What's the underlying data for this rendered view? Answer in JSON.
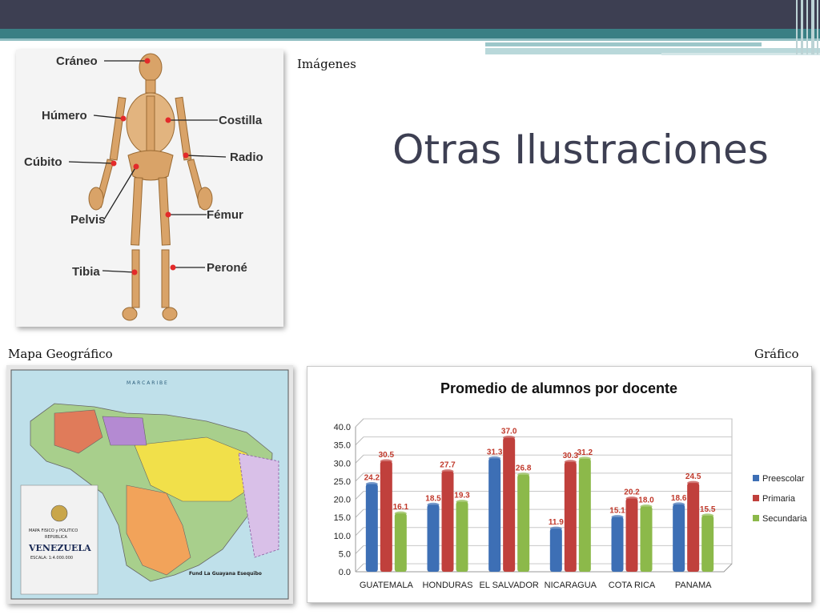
{
  "slide": {
    "title": "Otras Ilustraciones",
    "caption_images": "Imágenes",
    "caption_map": "Mapa Geográfico",
    "caption_chart": "Gráfico"
  },
  "skeleton": {
    "labels": [
      "Cráneo",
      "Húmero",
      "Costilla",
      "Cúbito",
      "Radio",
      "Pelvis",
      "Fémur",
      "Tibia",
      "Peroné"
    ]
  },
  "map": {
    "top_text": "M A R   C A R I B E",
    "legend_title_1": "MAPA FISICO y POLITICO",
    "legend_title_2": "REPUBLICA",
    "country": "VENEZUELA",
    "scale": "ESCALA: 1:4.000.000",
    "zone_label": "Fund La Guayana Esequibo"
  },
  "chart_data": {
    "type": "bar",
    "title": "Promedio de alumnos por docente",
    "categories": [
      "GUATEMALA",
      "HONDURAS",
      "EL SALVADOR",
      "NICARAGUA",
      "COTA RICA",
      "PANAMA"
    ],
    "series": [
      {
        "name": "Preescolar",
        "color": "#3d6fb5",
        "values": [
          24.2,
          18.5,
          31.3,
          11.9,
          15.1,
          18.6
        ]
      },
      {
        "name": "Primaria",
        "color": "#c0403c",
        "values": [
          30.5,
          27.7,
          37.0,
          30.3,
          20.2,
          24.5
        ]
      },
      {
        "name": "Secundaria",
        "color": "#8cb94a",
        "values": [
          16.1,
          19.3,
          26.8,
          31.2,
          18.0,
          15.5
        ]
      }
    ],
    "ylim": [
      0,
      40
    ],
    "yticks": [
      "0.0",
      "5.0",
      "10.0",
      "15.0",
      "20.0",
      "25.0",
      "30.0",
      "35.0",
      "40.0"
    ],
    "grid": true,
    "legend": "right"
  }
}
